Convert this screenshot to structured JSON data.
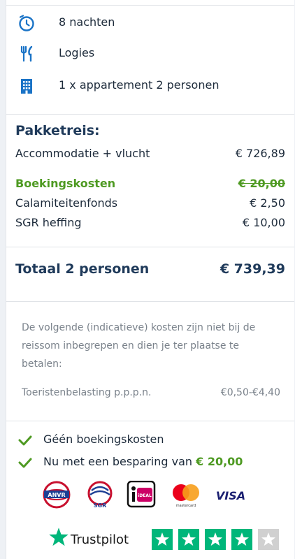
{
  "facts": [
    {
      "icon": "clock-icon",
      "text": "8 nachten"
    },
    {
      "icon": "fork-knife-icon",
      "text": "Logies"
    },
    {
      "icon": "building-icon",
      "text": "1 x appartement 2 personen"
    }
  ],
  "package": {
    "title": "Pakketreis:",
    "accommodation_label": "Accommodatie + vlucht",
    "accommodation_value": "€ 726,89",
    "booking_label": "Boekingskosten",
    "booking_value": "€ 20,00",
    "calamity_label": "Calamiteitenfonds",
    "calamity_value": "€ 2,50",
    "sgr_label": "SGR heffing",
    "sgr_value": "€ 10,00"
  },
  "total": {
    "label": "Totaal 2 personen",
    "value": "€ 739,39"
  },
  "extra_costs": {
    "note": "De volgende (indicatieve) kosten zijn niet bij de reissom inbegrepen en dien je ter plaatse te betalen:",
    "tax_label": "Toeristenbelasting p.p.p.n.",
    "tax_value": "€0,50-€4,40"
  },
  "benefits": {
    "no_fee": "Géén boekingskosten",
    "saving_prefix": "Nu met een besparing van",
    "saving_value": "€ 20,00"
  },
  "logos": {
    "anvr": "ANVR",
    "sgr": "SGR",
    "ideal": "iDEAL",
    "mastercard": "mastercard",
    "visa": "VISA"
  },
  "trustpilot": {
    "name": "Trustpilot",
    "stars": 4.5,
    "max_stars": 5
  },
  "colors": {
    "accent": "#1a73c6",
    "green": "#4e9a22",
    "title": "#1f3a5a",
    "trust_green": "#00b67a"
  }
}
